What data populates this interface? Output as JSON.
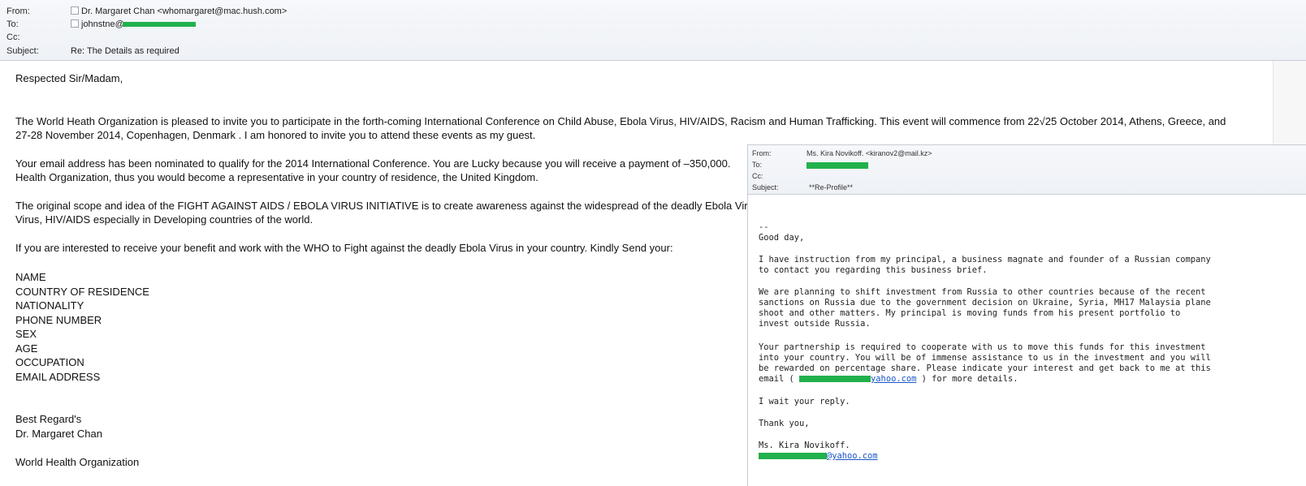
{
  "main_email": {
    "header": {
      "from_label": "From:",
      "from_value": "Dr. Margaret Chan <whomargaret@mac.hush.com>",
      "to_label": "To:",
      "to_value": "johnstne@",
      "cc_label": "Cc:",
      "subject_label": "Subject:",
      "subject_value": "Re: The Details as required"
    },
    "body": {
      "greeting": "Respected Sir/Madam,",
      "p1_line1": "The World Heath Organization is pleased to invite you to participate in the forth-coming International Conference on Child Abuse, Ebola Virus, HIV/AIDS, Racism and Human Trafficking. This event will commence from   22√25 October 2014, Athens, Greece, and",
      "p1_line2": "27-28 November 2014, Copenhagen, Denmark . I am honored to invite you to attend these events as my guest.",
      "p2_line1": "Your email address has been nominated to qualify for the 2014 International Conference. You are Lucky because you will receive a payment of –350,000.",
      "p2_line2": "Health Organization, thus you would become a representative in your country of residence, the United Kingdom.",
      "p3_line1": "The original scope and idea of the FIGHT AGAINST AIDS / EBOLA VIRUS INITIATIVE is to create awareness against the widespread of the deadly Ebola Viru",
      "p3_line2": "Virus, HIV/AIDS especially in Developing countries of the world.",
      "p4": "If you are interested to receive your benefit and work with the WHO to Fight against the deadly Ebola Virus in your country. Kindly Send your:",
      "fields": [
        "NAME",
        "COUNTRY OF RESIDENCE",
        "NATIONALITY",
        "PHONE NUMBER",
        "SEX",
        "AGE",
        "OCCUPATION",
        "EMAIL ADDRESS"
      ],
      "closing": "Best Regard's",
      "signature_name": "Dr. Margaret Chan",
      "signature_org": "World Health Organization"
    }
  },
  "overlay_email": {
    "header": {
      "from_label": "From:",
      "from_value": "Ms. Kira Novikoff. <kiranov2@mail.kz>",
      "to_label": "To:",
      "cc_label": "Cc:",
      "subject_label": "Subject:",
      "subject_value": "**Re-Profile**"
    },
    "body": {
      "sep": "--",
      "greeting": "Good day,",
      "p1_line1": "I have instruction from my principal, a business magnate and founder of a Russian company",
      "p1_line2": "to contact you regarding this business brief.",
      "p2_line1": "We are planning to shift investment from Russia to other countries because of the recent",
      "p2_line2": "sanctions on Russia due to the government decision on Ukraine, Syria, MH17 Malaysia plane",
      "p2_line3": "shoot and other matters. My principal is moving funds from his present portfolio to",
      "p2_line4": "invest outside Russia.",
      "p3_line1": "Your partnership is required to cooperate with us to move this funds for this investment",
      "p3_line2": "into your country. You will be of immense assistance to us in the investment and you will",
      "p3_line3": "be rewarded on percentage share. Please indicate your interest and get back to me at this",
      "p3_line4_prefix": "email ( ",
      "p3_line4_link": "yahoo.com",
      "p3_line4_suffix": " ) for more details.",
      "p4": "I wait your reply.",
      "thanks": "Thank you,",
      "signature_name": "Ms. Kira Novikoff.",
      "signature_email": "@yahoo.com"
    }
  },
  "colors": {
    "redaction": "#21b14c",
    "link": "#1a55c8",
    "header_bg": "#eef1f6"
  }
}
